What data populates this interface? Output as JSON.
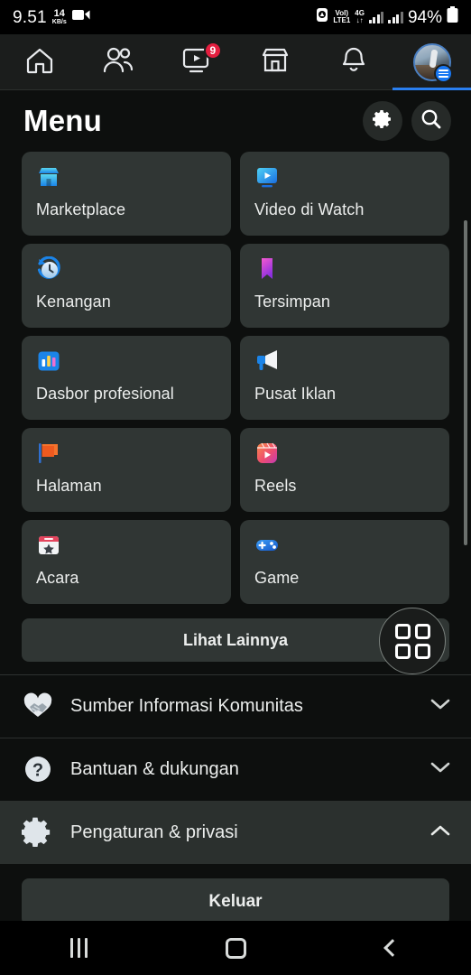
{
  "statusbar": {
    "time": "9.51",
    "data_rate_value": "14",
    "data_rate_unit": "KB/s",
    "screen_record_icon": "video-camera-icon",
    "app_icon": "app-notification-icon",
    "volte_line1": "VoI)",
    "volte_line2": "LTE1",
    "network_line1": "4G",
    "network_line2": "↓↑",
    "battery_percent": "94%"
  },
  "topnav": {
    "tabs": [
      {
        "name": "home",
        "icon": "home-icon",
        "badge": ""
      },
      {
        "name": "friends",
        "icon": "friends-icon",
        "badge": ""
      },
      {
        "name": "video",
        "icon": "video-watch-icon",
        "badge": "9"
      },
      {
        "name": "marketplace",
        "icon": "store-icon",
        "badge": ""
      },
      {
        "name": "notifications",
        "icon": "bell-icon",
        "badge": ""
      },
      {
        "name": "menu",
        "icon": "profile-avatar-icon",
        "badge": ""
      }
    ],
    "active_tab_index": 5
  },
  "header": {
    "title": "Menu",
    "settings_icon": "gear-icon",
    "search_icon": "search-icon"
  },
  "grid": {
    "tiles": [
      {
        "label": "Marketplace",
        "icon": "marketplace-storefront-icon"
      },
      {
        "label": "Video di Watch",
        "icon": "video-watch-icon"
      },
      {
        "label": "Kenangan",
        "icon": "memories-clock-icon"
      },
      {
        "label": "Tersimpan",
        "icon": "saved-bookmark-icon"
      },
      {
        "label": "Dasbor profesional",
        "icon": "professional-dashboard-chart-icon"
      },
      {
        "label": "Pusat Iklan",
        "icon": "ad-center-megaphone-icon"
      },
      {
        "label": "Halaman",
        "icon": "pages-flag-icon"
      },
      {
        "label": "Reels",
        "icon": "reels-clapboard-icon"
      },
      {
        "label": "Acara",
        "icon": "events-calendar-icon"
      },
      {
        "label": "Game",
        "icon": "gaming-controller-icon"
      }
    ]
  },
  "see_more": {
    "label": "Lihat Lainnya",
    "fab_icon": "grid-apps-icon"
  },
  "list": {
    "rows": [
      {
        "label": "Sumber Informasi Komunitas",
        "icon": "community-heart-handshake-icon",
        "chevron": "chevron-down-icon",
        "selected": false
      },
      {
        "label": "Bantuan & dukungan",
        "icon": "help-question-icon",
        "chevron": "chevron-down-icon",
        "selected": false
      },
      {
        "label": "Pengaturan & privasi",
        "icon": "settings-gear-icon",
        "chevron": "chevron-up-icon",
        "selected": true
      }
    ]
  },
  "logout": {
    "label": "Keluar"
  },
  "androidnav": {
    "recents_label": "recents-icon",
    "home_label": "home-icon",
    "back_label": "back-icon"
  },
  "colors": {
    "background": "#0d0f0e",
    "tile": "#303634",
    "accent_blue": "#2a7ff0",
    "badge_red": "#e41e3f",
    "text": "#eceeed"
  }
}
